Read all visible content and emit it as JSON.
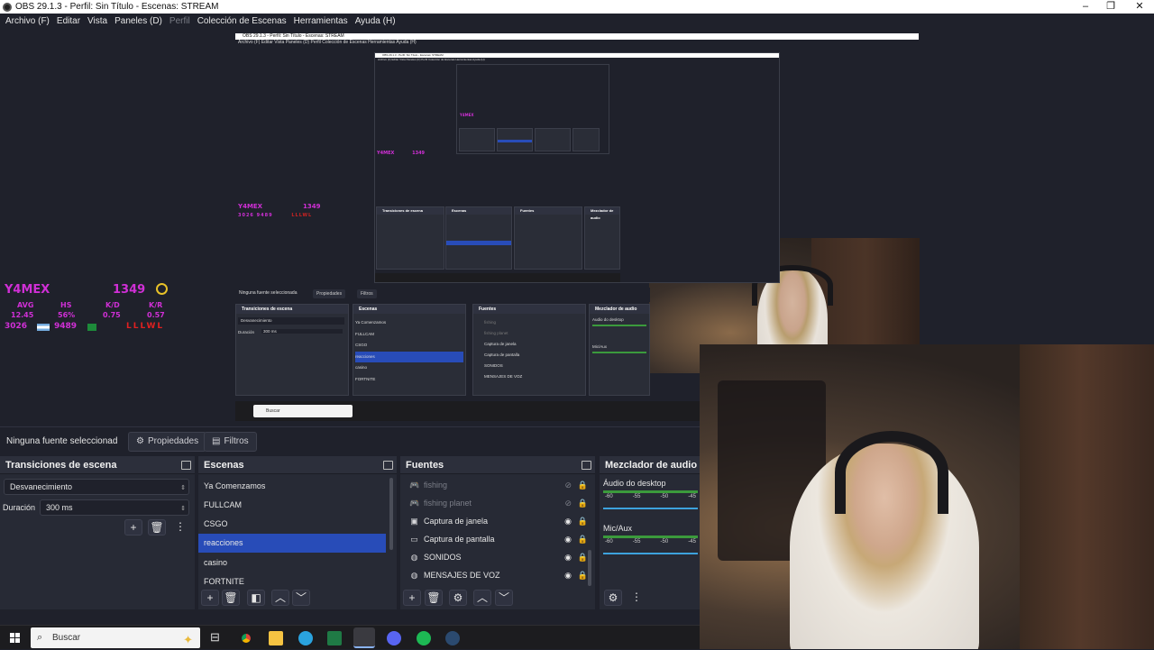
{
  "window": {
    "title": "OBS 29.1.3 - Perfil: Sin Título - Escenas: STREAM"
  },
  "menu": [
    {
      "label": "Archivo (F)",
      "disabled": false
    },
    {
      "label": "Editar",
      "disabled": false
    },
    {
      "label": "Vista",
      "disabled": false
    },
    {
      "label": "Paneles (D)",
      "disabled": false
    },
    {
      "label": "Perfil",
      "disabled": true
    },
    {
      "label": "Colección de Escenas",
      "disabled": false
    },
    {
      "label": "Herramientas",
      "disabled": false
    },
    {
      "label": "Ayuda (H)",
      "disabled": false
    }
  ],
  "hud": {
    "name": "Y4MEX",
    "score": "1349",
    "labels": [
      "AVG",
      "HS",
      "K/D",
      "K/R"
    ],
    "values": [
      "12.45",
      "56%",
      "0.75",
      "0.57"
    ],
    "rank_a": "3026",
    "rank_b": "9489",
    "streak": "LLLWL"
  },
  "preview_nested": {
    "title": "OBS 29.1.3 - Perfil: Sin Título - Escenas: STREAM",
    "menu": "Archivo (F)   Editar   Vista   Paneles (D)   Perfil   Colección de Escenas   Herramientas   Ayuda (H)",
    "no_source": "Ninguna fuente seleccionada",
    "props": "Propiedades",
    "filters": "Filtros",
    "transitions": "Transiciones de escena",
    "transition_val": "Desvanecimiento",
    "duration_label": "Duración",
    "duration_val": "300 ms",
    "scenes": "Escenas",
    "sources": "Fuentes",
    "mixer": "Mezclador de audio",
    "desktop_audio": "Audio do desktop",
    "mic": "Mic/Aux",
    "search": "Buscar"
  },
  "source_bar": {
    "no_source": "Ninguna fuente seleccionad",
    "properties": "Propiedades",
    "filters": "Filtros"
  },
  "transitions": {
    "title": "Transiciones de escena",
    "transition": "Desvanecimiento",
    "duration_label": "Duración",
    "duration": "300 ms"
  },
  "scenes": {
    "title": "Escenas",
    "items": [
      "Ya Comenzamos",
      "FULLCAM",
      "CSGO",
      "reacciones",
      "casino",
      "FORTNITE"
    ],
    "selected_index": 3
  },
  "sources": {
    "title": "Fuentes",
    "items": [
      {
        "label": "fishing",
        "visible": false,
        "icon": "gamepad-icon"
      },
      {
        "label": "fishing planet",
        "visible": false,
        "icon": "gamepad-icon"
      },
      {
        "label": "Captura de janela",
        "visible": true,
        "icon": "window-icon"
      },
      {
        "label": "Captura de pantalla",
        "visible": true,
        "icon": "monitor-icon"
      },
      {
        "label": "SONIDOS",
        "visible": true,
        "icon": "globe-icon"
      },
      {
        "label": "MENSAJES DE VOZ",
        "visible": true,
        "icon": "globe-icon"
      }
    ]
  },
  "mixer": {
    "title": "Mezclador de audio",
    "channels": [
      {
        "name": "Áudio do desktop",
        "ticks": [
          "-60",
          "-55",
          "-50",
          "-45"
        ]
      },
      {
        "name": "Mic/Aux",
        "ticks": [
          "-60",
          "-55",
          "-50",
          "-45"
        ]
      }
    ]
  },
  "taskbar": {
    "search": "Buscar"
  },
  "colors": {
    "accent": "#284cb8",
    "panel": "#272a35",
    "bg": "#1f212b",
    "hud": "#d02fd6"
  }
}
